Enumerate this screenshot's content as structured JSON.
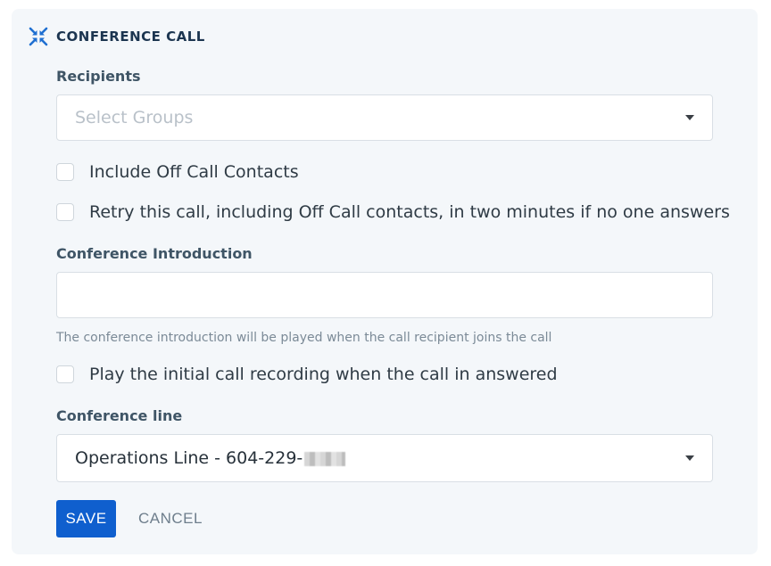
{
  "header": {
    "title": "CONFERENCE CALL",
    "icon": "compress-arrows-icon",
    "accent": "#1f6fd1"
  },
  "recipients": {
    "label": "Recipients",
    "placeholder": "Select Groups"
  },
  "options": {
    "include_off_call": "Include Off Call Contacts",
    "retry": "Retry this call, including Off Call contacts, in two minutes if no one answers",
    "play_recording": "Play the initial call recording when the call in answered"
  },
  "introduction": {
    "label": "Conference Introduction",
    "value": "",
    "hint": "The conference introduction will be played when the call recipient joins the call"
  },
  "conference_line": {
    "label": "Conference line",
    "value": "Operations Line - 604-229-"
  },
  "actions": {
    "save": "SAVE",
    "cancel": "CANCEL"
  }
}
